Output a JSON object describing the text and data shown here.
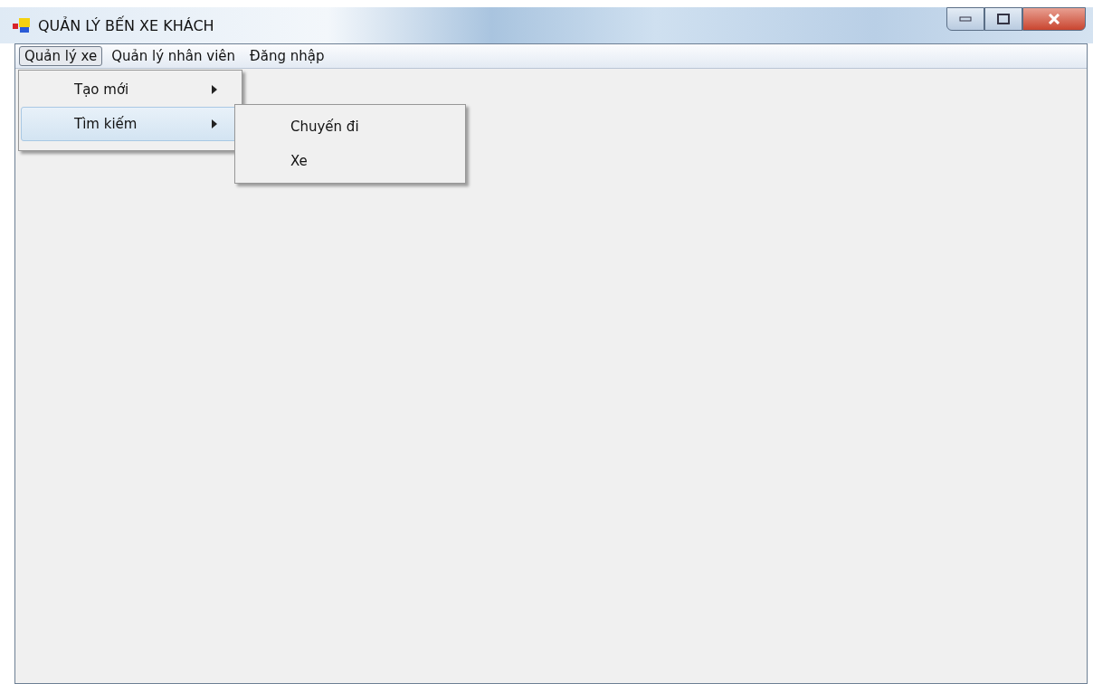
{
  "window": {
    "title": "QUẢN LÝ BẾN XE KHÁCH"
  },
  "menu_bar": [
    {
      "label": "Quản lý xe",
      "selected": true
    },
    {
      "label": "Quản lý nhân viên",
      "selected": false
    },
    {
      "label": "Đăng nhập",
      "selected": false
    }
  ],
  "dropdown": [
    {
      "label": "Tạo mới",
      "selected": false
    },
    {
      "label": "Tìm kiếm",
      "selected": true
    }
  ],
  "submenu": [
    {
      "label": "Chuyến đi"
    },
    {
      "label": "Xe"
    }
  ]
}
